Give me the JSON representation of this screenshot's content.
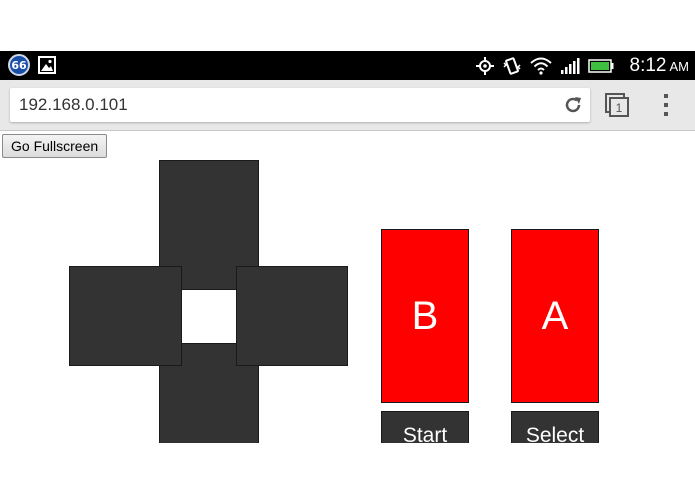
{
  "status_bar": {
    "notification_count": "66",
    "icons": [
      "notification-badge",
      "picture-icon",
      "gps-icon",
      "vibrate-icon",
      "wifi-icon",
      "signal-icon",
      "battery-icon"
    ],
    "time": "8:12",
    "ampm": "AM"
  },
  "browser": {
    "url": "192.168.0.101",
    "tab_count": "1",
    "icons": [
      "reload-icon",
      "tabs-icon",
      "menu-icon"
    ]
  },
  "page": {
    "fullscreen_label": "Go Fullscreen"
  },
  "controller": {
    "dpad": [
      "up",
      "left",
      "right",
      "down"
    ],
    "b_label": "B",
    "a_label": "A",
    "start_label": "Start",
    "select_label": "Select",
    "colors": {
      "pad": "#333333",
      "action_button": "#ff0000",
      "text": "#ffffff"
    }
  }
}
